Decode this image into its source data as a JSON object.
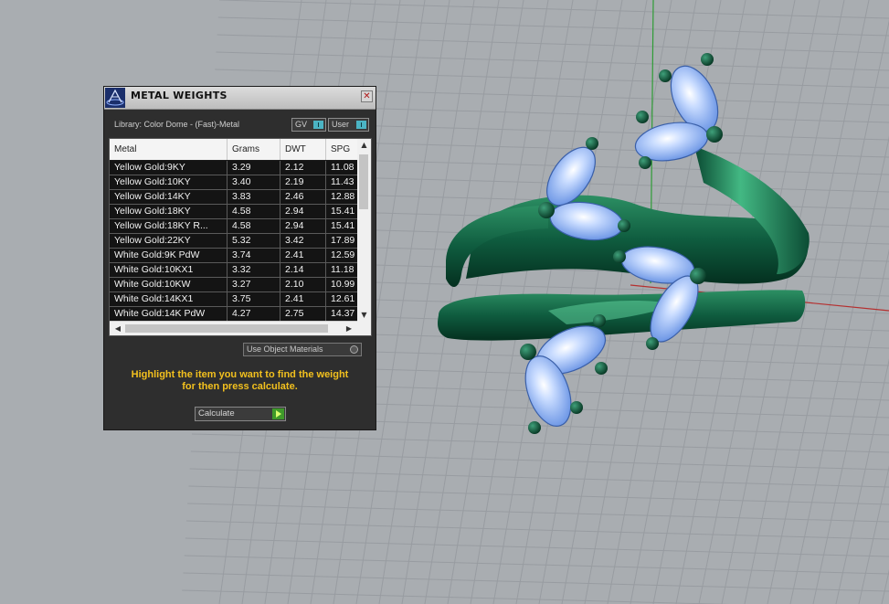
{
  "window": {
    "title": "METAL WEIGHTS",
    "close_glyph": "✕",
    "library_label": "Library: Color Dome - (Fast)-Metal",
    "toggles": [
      {
        "label": "GV",
        "icon": "toggle-indicator"
      },
      {
        "label": "User",
        "icon": "toggle-indicator"
      }
    ]
  },
  "table": {
    "columns": [
      "Metal",
      "Grams",
      "DWT",
      "SPG"
    ],
    "rows": [
      [
        "Yellow Gold:9KY",
        "3.29",
        "2.12",
        "11.08"
      ],
      [
        "Yellow Gold:10KY",
        "3.40",
        "2.19",
        "11.43"
      ],
      [
        "Yellow Gold:14KY",
        "3.83",
        "2.46",
        "12.88"
      ],
      [
        "Yellow Gold:18KY",
        "4.58",
        "2.94",
        "15.41"
      ],
      [
        "Yellow Gold:18KY R...",
        "4.58",
        "2.94",
        "15.41"
      ],
      [
        "Yellow Gold:22KY",
        "5.32",
        "3.42",
        "17.89"
      ],
      [
        "White Gold:9K PdW",
        "3.74",
        "2.41",
        "12.59"
      ],
      [
        "White Gold:10KX1",
        "3.32",
        "2.14",
        "11.18"
      ],
      [
        "White Gold:10KW",
        "3.27",
        "2.10",
        "10.99"
      ],
      [
        "White Gold:14KX1",
        "3.75",
        "2.41",
        "12.61"
      ],
      [
        "White Gold:14K PdW",
        "4.27",
        "2.75",
        "14.37"
      ]
    ],
    "scroll_up_glyph": "▲",
    "scroll_down_glyph": "▼",
    "scroll_left_glyph": "◀",
    "scroll_right_glyph": "▶"
  },
  "options": {
    "use_object_materials": "Use Object Materials"
  },
  "hint": {
    "line1": "Highlight the item you want to find the weight",
    "line2": "for then press calculate."
  },
  "calculate": {
    "label": "Calculate",
    "icon": "play-icon"
  },
  "colors": {
    "metal": "#0f5c3f",
    "gem": "#8fb6f2",
    "hint_text": "#f2c01e",
    "viewport_bg": "#a9adb1"
  }
}
